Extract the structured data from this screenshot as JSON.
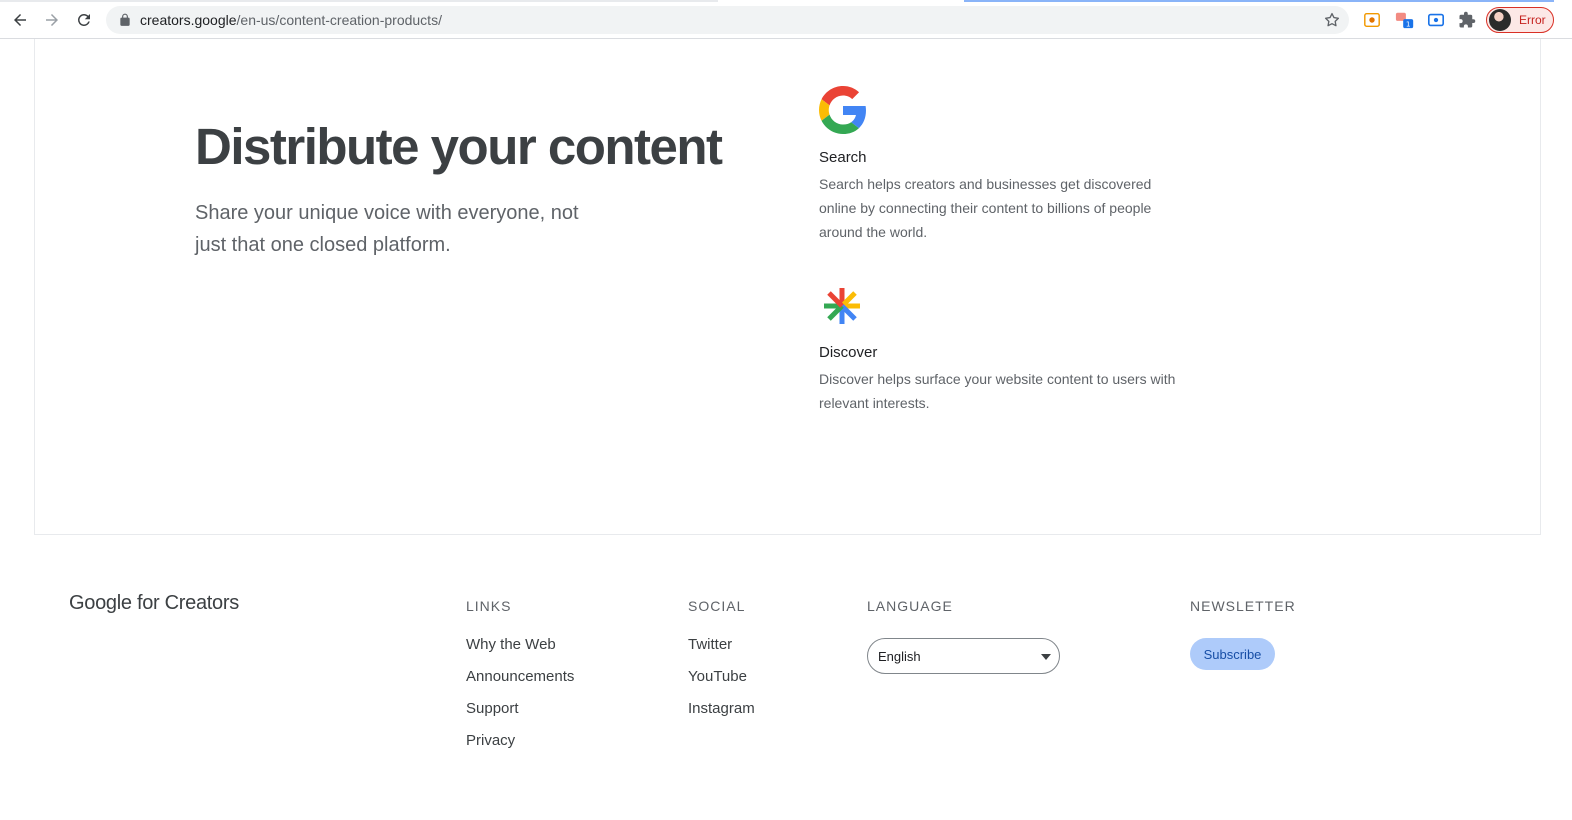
{
  "browser": {
    "url_host": "creators.google",
    "url_path": "/en-us/content-creation-products/",
    "profile_label": "Error"
  },
  "hero": {
    "title": "Distribute your content",
    "subtitle": "Share your unique voice with everyone, not just that one closed platform."
  },
  "products": [
    {
      "title": "Search",
      "description": "Search helps creators and businesses get discovered online by connecting their content to billions of people around the world.",
      "icon": "google-g-icon"
    },
    {
      "title": "Discover",
      "description": "Discover helps surface your website content to users with relevant interests.",
      "icon": "discover-asterisk-icon"
    }
  ],
  "footer": {
    "brand": "Google for Creators",
    "links": {
      "heading": "LINKS",
      "items": [
        "Why the Web",
        "Announcements",
        "Support",
        "Privacy"
      ]
    },
    "social": {
      "heading": "SOCIAL",
      "items": [
        "Twitter",
        "YouTube",
        "Instagram"
      ]
    },
    "language": {
      "heading": "LANGUAGE",
      "selected": "English"
    },
    "newsletter": {
      "heading": "NEWSLETTER",
      "button_label": "Subscribe"
    }
  },
  "colors": {
    "google_blue": "#4285F4",
    "google_red": "#EA4335",
    "google_yellow": "#FBBC05",
    "google_green": "#34A853",
    "subscribe_bg": "#aecbfa"
  }
}
